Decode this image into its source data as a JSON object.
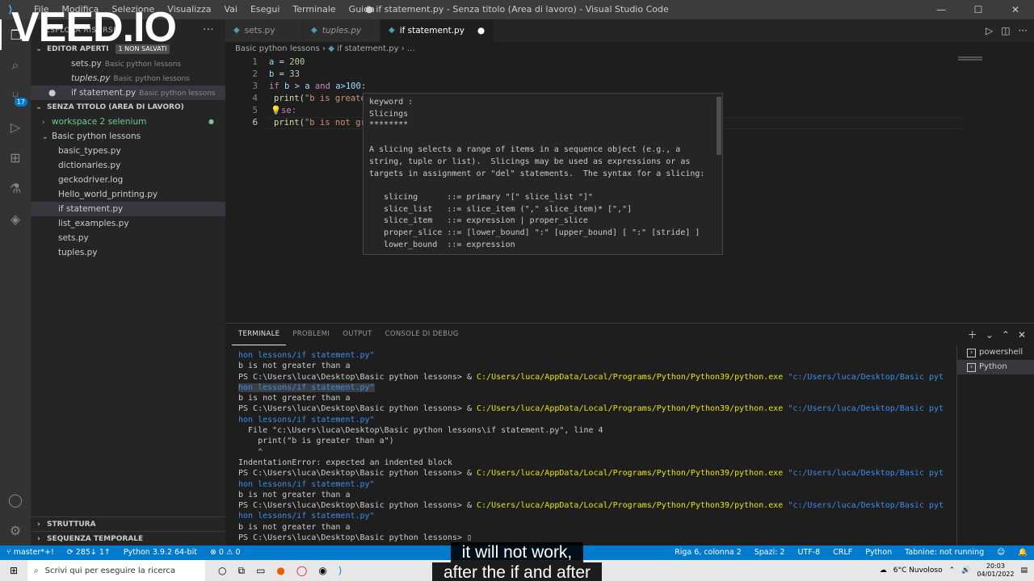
{
  "window": {
    "menu": [
      "File",
      "Modifica",
      "Selezione",
      "Visualizza",
      "Vai",
      "Esegui",
      "Terminale",
      "Guida"
    ],
    "title": "● if statement.py - Senza titolo (Area di lavoro) - Visual Studio Code",
    "controls": [
      "—",
      "☐",
      "✕"
    ]
  },
  "activity": {
    "icons": [
      "files-icon",
      "search-icon",
      "source-control-icon",
      "run-debug-icon",
      "extensions-icon",
      "testing-icon",
      "layers-icon"
    ],
    "scm_badge": "17"
  },
  "sidebar": {
    "title": "ESPLORA RISORSE",
    "open_editors": {
      "title": "EDITOR APERTI",
      "badge": "1 NON SALVATI",
      "items": [
        {
          "name": "sets.py",
          "desc": "Basic python lessons"
        },
        {
          "name": "tuples.py",
          "desc": "Basic python lessons"
        },
        {
          "name": "if statement.py",
          "desc": "Basic python lessons"
        }
      ]
    },
    "workspace": {
      "title": "SENZA TITOLO (AREA DI LAVORO)",
      "folders": [
        "workspace 2 selenium",
        "Basic python lessons"
      ],
      "files": [
        "basic_types.py",
        "dictionaries.py",
        "geckodriver.log",
        "Hello_world_printing.py",
        "if statement.py",
        "list_examples.py",
        "sets.py",
        "tuples.py"
      ]
    },
    "bottom": [
      "STRUTTURA",
      "SEQUENZA TEMPORALE"
    ]
  },
  "editor": {
    "tabs": [
      {
        "label": "sets.py"
      },
      {
        "label": "tuples.py"
      },
      {
        "label": "if statement.py"
      }
    ],
    "breadcrumb": [
      "Basic python lessons",
      "if statement.py",
      "..."
    ],
    "line_numbers": [
      "1",
      "2",
      "3",
      "4",
      "5",
      "6"
    ],
    "code": {
      "l1": [
        "a",
        " = ",
        "200"
      ],
      "l2": [
        "b",
        " = ",
        "33"
      ],
      "l3": [
        "if",
        " b > a ",
        "and",
        " a>100:"
      ],
      "l4": [
        "print",
        "(",
        "\"b is greate",
        ""
      ],
      "l5": [
        "se:"
      ],
      "l6": [
        "print",
        "(",
        "\"b is not gr"
      ]
    }
  },
  "hover": {
    "lines": [
      "keyword :",
      "Slicings",
      "********",
      "",
      "A slicing selects a range of items in a sequence object (e.g., a",
      "string, tuple or list).  Slicings may be used as expressions or as",
      "targets in assignment or \"del\" statements.  The syntax for a slicing:",
      "",
      "   slicing      ::= primary \"[\" slice_list \"]\"",
      "   slice_list   ::= slice_item (\",\" slice_item)* [\",\"]",
      "   slice_item   ::= expression | proper_slice",
      "   proper_slice ::= [lower_bound] \":\" [upper_bound] [ \":\" [stride] ]",
      "   lower_bound  ::= expression"
    ]
  },
  "panel": {
    "tabs": [
      "TERMINALE",
      "PROBLEMI",
      "OUTPUT",
      "CONSOLE DI DEBUG"
    ],
    "terminals": [
      "powershell",
      "Python"
    ],
    "prompt": "PS C:\\Users\\luca\\Desktop\\Basic python lessons> & ",
    "python_path": "C:/Users/luca/AppData/Local/Programs/Python/Python39/python.exe",
    "script_path_start": "\"c:/Users/luca/Desktop/Basic pyt",
    "script_path_end": "hon lessons/if statement.py\"",
    "output_line": "b is not greater than a",
    "error_lines": [
      "  File \"c:\\Users\\luca\\Desktop\\Basic python lessons\\if statement.py\", line 4",
      "    print(\"b is greater than a\")",
      "    ^",
      "IndentationError: expected an indented block"
    ],
    "last_prompt": "PS C:\\Users\\luca\\Desktop\\Basic python lessons> "
  },
  "status": {
    "branch": "master*+!",
    "sync": "285↓ 1↑",
    "interpreter": "Python 3.9.2 64-bit",
    "problems": "⊗ 0 ⚠ 0",
    "position": "Riga 6, colonna 2",
    "spaces": "Spazi: 2",
    "encoding": "UTF-8",
    "eol": "CRLF",
    "language": "Python",
    "server": "Tabnine: not running"
  },
  "taskbar": {
    "search_placeholder": "Scrivi qui per eseguire la ricerca",
    "weather": "6°C  Nuvoloso",
    "time": "20:03",
    "date": "04/01/2022"
  },
  "overlay": {
    "watermark": "VEED.IO",
    "subtitle_1": "it will not work,",
    "subtitle_2": "after the if and after"
  }
}
